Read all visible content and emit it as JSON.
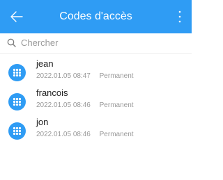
{
  "header": {
    "title": "Codes d'accès",
    "color": "#2f9cf4",
    "back_icon": "arrow-left-icon",
    "menu_icon": "more-vertical-icon"
  },
  "search": {
    "placeholder": "Chercher",
    "icon": "search-icon"
  },
  "items": [
    {
      "name": "jean",
      "datetime": "2022.01.05 08:47",
      "type": "Permanent"
    },
    {
      "name": "francois",
      "datetime": "2022.01.05 08:46",
      "type": "Permanent"
    },
    {
      "name": "jon",
      "datetime": "2022.01.05 08:46",
      "type": "Permanent"
    }
  ]
}
